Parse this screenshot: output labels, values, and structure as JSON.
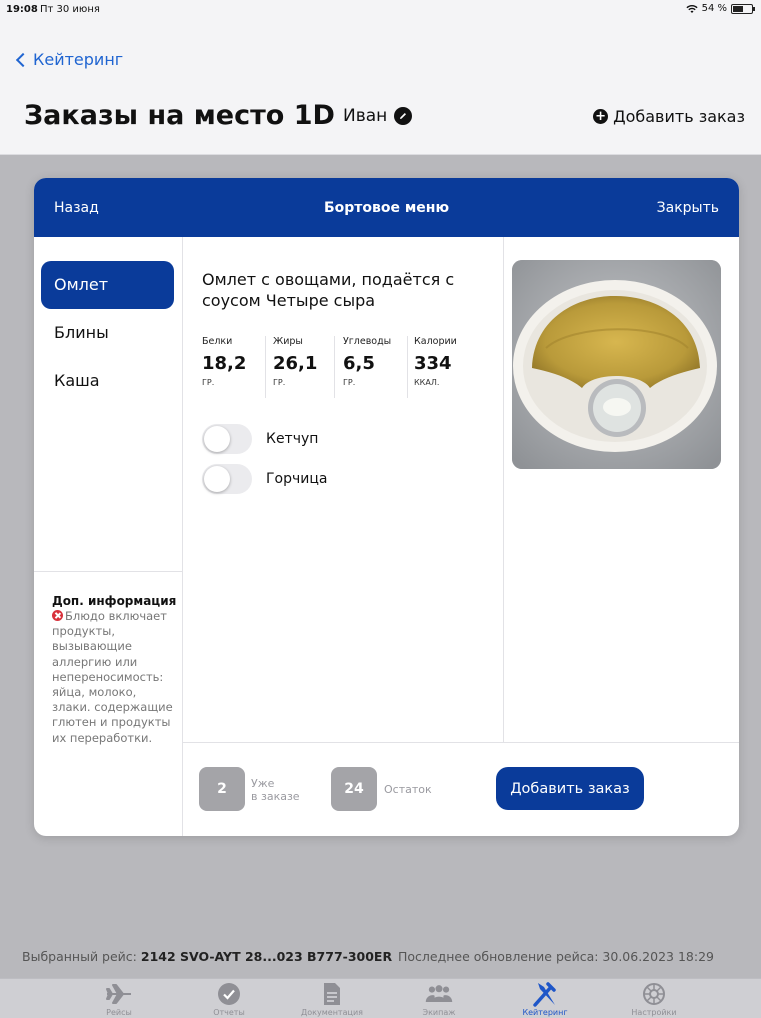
{
  "status_bar": {
    "time": "19:08",
    "date": "Пт 30 июня",
    "battery": "54 %"
  },
  "nav": {
    "back_label": "Кейтеринг"
  },
  "header": {
    "title": "Заказы на место 1D",
    "user_name": "Иван",
    "add_order_label": "Добавить заказ"
  },
  "modal": {
    "back_label": "Назад",
    "title": "Бортовое меню",
    "close_label": "Закрыть",
    "menu_items": [
      {
        "label": "Омлет",
        "active": true
      },
      {
        "label": "Блины",
        "active": false
      },
      {
        "label": "Каша",
        "active": false
      }
    ],
    "info": {
      "title": "Доп. информация",
      "text": "Блюдо включает продукты, вызывающие аллергию или непереносимость: яйца, молоко, злаки. содержащие глютен и продукты их переработки."
    },
    "dish": {
      "name": "Омлет с овощами, подаётся с соусом Четыре сыра",
      "nutrition": [
        {
          "label": "Белки",
          "value": "18,2",
          "unit": "ГР."
        },
        {
          "label": "Жиры",
          "value": "26,1",
          "unit": "ГР."
        },
        {
          "label": "Углеводы",
          "value": "6,5",
          "unit": "ГР."
        },
        {
          "label": "Калории",
          "value": "334",
          "unit": "ККАЛ."
        }
      ],
      "options": [
        {
          "label": "Кетчуп",
          "on": false
        },
        {
          "label": "Горчица",
          "on": false
        }
      ]
    },
    "footer": {
      "in_order_count": "2",
      "in_order_label_1": "Уже",
      "in_order_label_2": "в заказе",
      "remaining_count": "24",
      "remaining_label": "Остаток",
      "add_button_label": "Добавить заказ"
    }
  },
  "flight_info": {
    "selected_label": "Выбранный рейс:",
    "selected_value": "2142 SVO-AYT 28...023 B777-300ER",
    "update_label": "Последнее обновление рейса: 30.06.2023 18:29"
  },
  "tab_bar": {
    "tabs": [
      {
        "label": "Рейсы",
        "icon": "airplane-icon",
        "active": false
      },
      {
        "label": "Отчеты",
        "icon": "checkmark-circle-icon",
        "active": false
      },
      {
        "label": "Документация",
        "icon": "document-icon",
        "active": false
      },
      {
        "label": "Экипаж",
        "icon": "people-icon",
        "active": false
      },
      {
        "label": "Кейтеринг",
        "icon": "fork-knife-icon",
        "active": true
      },
      {
        "label": "Настройки",
        "icon": "gear-icon",
        "active": false
      }
    ]
  },
  "colors": {
    "accent": "#0a3b9a",
    "link": "#2065d1",
    "allergy_alert": "#d8323c"
  }
}
